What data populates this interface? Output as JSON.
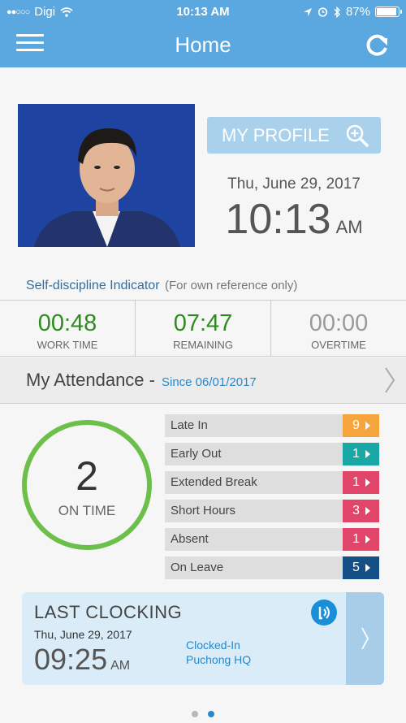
{
  "status_bar": {
    "carrier": "Digi",
    "time": "10:13 AM",
    "battery": "87%"
  },
  "nav": {
    "title": "Home",
    "menu_icon": "hamburger-icon",
    "refresh_icon": "refresh-icon"
  },
  "profile": {
    "button_label": "MY PROFILE",
    "date": "Thu, June 29, 2017",
    "time_hm": "10:13",
    "time_ampm": "AM"
  },
  "indicator": {
    "title": "Self-discipline Indicator",
    "note": "(For own reference only)",
    "stats": [
      {
        "value": "00:48",
        "label": "WORK TIME",
        "color": "#2e8b1e"
      },
      {
        "value": "07:47",
        "label": "REMAINING",
        "color": "#2e8b1e"
      },
      {
        "value": "00:00",
        "label": "OVERTIME",
        "color": "#9a9a9a"
      }
    ]
  },
  "attendance": {
    "title": "My Attendance -",
    "since": "Since 06/01/2017",
    "on_time_count": "2",
    "on_time_label": "ON TIME",
    "items": [
      {
        "label": "Late In",
        "count": "9",
        "color": "#f5a53c"
      },
      {
        "label": "Early Out",
        "count": "1",
        "color": "#1aa8a6"
      },
      {
        "label": "Extended Break",
        "count": "1",
        "color": "#e2456a"
      },
      {
        "label": "Short Hours",
        "count": "3",
        "color": "#e2456a"
      },
      {
        "label": "Absent",
        "count": "1",
        "color": "#e2456a"
      },
      {
        "label": "On Leave",
        "count": "5",
        "color": "#164f86"
      }
    ]
  },
  "last_clocking": {
    "title": "LAST CLOCKING",
    "date": "Thu, June 29, 2017",
    "time_hm": "09:25",
    "time_ampm": "AM",
    "status": "Clocked-In",
    "location": "Puchong HQ"
  },
  "pager": {
    "total": 2,
    "active": 2
  }
}
